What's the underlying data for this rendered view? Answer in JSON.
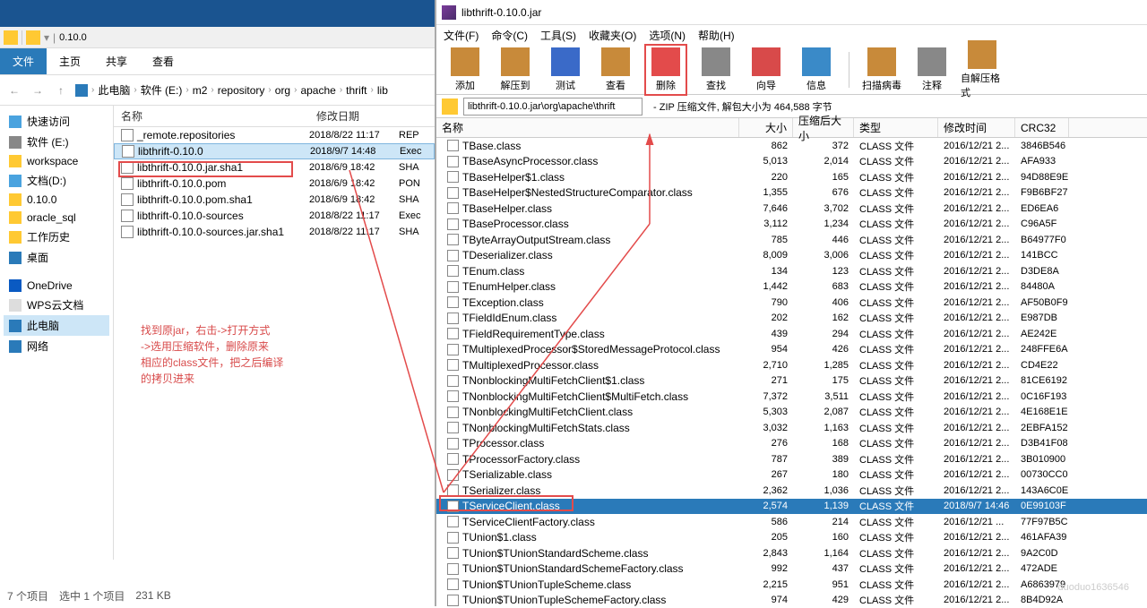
{
  "explorer": {
    "addressbar_text": "0.10.0",
    "tabs": [
      "文件",
      "主页",
      "共享",
      "查看"
    ],
    "breadcrumb": [
      "此电脑",
      "软件 (E:)",
      "m2",
      "repository",
      "org",
      "apache",
      "thrift",
      "lib"
    ],
    "sidebar": [
      {
        "icon": "sb-star",
        "label": "快速访问"
      },
      {
        "icon": "sb-disk",
        "label": "软件 (E:)"
      },
      {
        "icon": "sb-folder",
        "label": "workspace"
      },
      {
        "icon": "sb-doc",
        "label": "文档(D:)"
      },
      {
        "icon": "sb-folder",
        "label": "0.10.0"
      },
      {
        "icon": "sb-folder",
        "label": "oracle_sql"
      },
      {
        "icon": "sb-folder",
        "label": "工作历史"
      },
      {
        "icon": "sb-desktop",
        "label": "桌面"
      },
      {
        "icon": "",
        "label": ""
      },
      {
        "icon": "sb-cloud",
        "label": "OneDrive"
      },
      {
        "icon": "sb-wps",
        "label": "WPS云文档"
      },
      {
        "icon": "sb-pc",
        "label": "此电脑",
        "active": true
      },
      {
        "icon": "sb-net",
        "label": "网络"
      }
    ],
    "columns": {
      "name": "名称",
      "date": "修改日期",
      "type": ""
    },
    "files": [
      {
        "name": "_remote.repositories",
        "date": "2018/8/22 11:17",
        "type": "REP"
      },
      {
        "name": "libthrift-0.10.0",
        "date": "2018/9/7 14:48",
        "type": "Exec",
        "selected": true
      },
      {
        "name": "libthrift-0.10.0.jar.sha1",
        "date": "2018/6/9 18:42",
        "type": "SHA"
      },
      {
        "name": "libthrift-0.10.0.pom",
        "date": "2018/6/9 18:42",
        "type": "PON"
      },
      {
        "name": "libthrift-0.10.0.pom.sha1",
        "date": "2018/6/9 18:42",
        "type": "SHA"
      },
      {
        "name": "libthrift-0.10.0-sources",
        "date": "2018/8/22 11:17",
        "type": "Exec"
      },
      {
        "name": "libthrift-0.10.0-sources.jar.sha1",
        "date": "2018/8/22 11:17",
        "type": "SHA"
      }
    ],
    "statusbar": {
      "items": "7 个项目",
      "selected": "选中 1 个项目",
      "size": "231 KB"
    }
  },
  "annotation": {
    "line1": "找到原jar，右击->打开方式",
    "line2": "->选用压缩软件，删除原来",
    "line3": "相应的class文件，把之后编译",
    "line4": "的拷贝进来"
  },
  "winrar": {
    "title": "libthrift-0.10.0.jar",
    "menu": [
      "文件(F)",
      "命令(C)",
      "工具(S)",
      "收藏夹(O)",
      "选项(N)",
      "帮助(H)"
    ],
    "tools": [
      {
        "label": "添加",
        "color": "#c88a3a"
      },
      {
        "label": "解压到",
        "color": "#c88a3a"
      },
      {
        "label": "测试",
        "color": "#3a6ac8"
      },
      {
        "label": "查看",
        "color": "#c88a3a"
      },
      {
        "label": "删除",
        "color": "#e34b4b",
        "boxed": true
      },
      {
        "label": "查找",
        "color": "#888"
      },
      {
        "label": "向导",
        "color": "#d84a4a"
      },
      {
        "label": "信息",
        "color": "#3a8ac8"
      },
      {
        "label": "",
        "sep": true
      },
      {
        "label": "扫描病毒",
        "color": "#c88a3a"
      },
      {
        "label": "注释",
        "color": "#888"
      },
      {
        "label": "自解压格式",
        "color": "#c88a3a"
      }
    ],
    "address": "libthrift-0.10.0.jar\\org\\apache\\thrift",
    "address_info": "- ZIP 压缩文件, 解包大小为 464,588 字节",
    "columns": {
      "name": "名称",
      "size": "大小",
      "packed": "压缩后大小",
      "type": "类型",
      "date": "修改时间",
      "crc": "CRC32"
    },
    "rows": [
      {
        "name": "TBase.class",
        "size": "862",
        "packed": "372",
        "type": "CLASS 文件",
        "date": "2016/12/21 2...",
        "crc": "3846B546"
      },
      {
        "name": "TBaseAsyncProcessor.class",
        "size": "5,013",
        "packed": "2,014",
        "type": "CLASS 文件",
        "date": "2016/12/21 2...",
        "crc": "AFA933"
      },
      {
        "name": "TBaseHelper$1.class",
        "size": "220",
        "packed": "165",
        "type": "CLASS 文件",
        "date": "2016/12/21 2...",
        "crc": "94D88E9E"
      },
      {
        "name": "TBaseHelper$NestedStructureComparator.class",
        "size": "1,355",
        "packed": "676",
        "type": "CLASS 文件",
        "date": "2016/12/21 2...",
        "crc": "F9B6BF27"
      },
      {
        "name": "TBaseHelper.class",
        "size": "7,646",
        "packed": "3,702",
        "type": "CLASS 文件",
        "date": "2016/12/21 2...",
        "crc": "ED6EA6"
      },
      {
        "name": "TBaseProcessor.class",
        "size": "3,112",
        "packed": "1,234",
        "type": "CLASS 文件",
        "date": "2016/12/21 2...",
        "crc": "C96A5F"
      },
      {
        "name": "TByteArrayOutputStream.class",
        "size": "785",
        "packed": "446",
        "type": "CLASS 文件",
        "date": "2016/12/21 2...",
        "crc": "B64977F0"
      },
      {
        "name": "TDeserializer.class",
        "size": "8,009",
        "packed": "3,006",
        "type": "CLASS 文件",
        "date": "2016/12/21 2...",
        "crc": "141BCC"
      },
      {
        "name": "TEnum.class",
        "size": "134",
        "packed": "123",
        "type": "CLASS 文件",
        "date": "2016/12/21 2...",
        "crc": "D3DE8A"
      },
      {
        "name": "TEnumHelper.class",
        "size": "1,442",
        "packed": "683",
        "type": "CLASS 文件",
        "date": "2016/12/21 2...",
        "crc": "84480A"
      },
      {
        "name": "TException.class",
        "size": "790",
        "packed": "406",
        "type": "CLASS 文件",
        "date": "2016/12/21 2...",
        "crc": "AF50B0F9"
      },
      {
        "name": "TFieldIdEnum.class",
        "size": "202",
        "packed": "162",
        "type": "CLASS 文件",
        "date": "2016/12/21 2...",
        "crc": "E987DB"
      },
      {
        "name": "TFieldRequirementType.class",
        "size": "439",
        "packed": "294",
        "type": "CLASS 文件",
        "date": "2016/12/21 2...",
        "crc": "AE242E"
      },
      {
        "name": "TMultiplexedProcessor$StoredMessageProtocol.class",
        "size": "954",
        "packed": "426",
        "type": "CLASS 文件",
        "date": "2016/12/21 2...",
        "crc": "248FFE6A"
      },
      {
        "name": "TMultiplexedProcessor.class",
        "size": "2,710",
        "packed": "1,285",
        "type": "CLASS 文件",
        "date": "2016/12/21 2...",
        "crc": "CD4E22"
      },
      {
        "name": "TNonblockingMultiFetchClient$1.class",
        "size": "271",
        "packed": "175",
        "type": "CLASS 文件",
        "date": "2016/12/21 2...",
        "crc": "81CE6192"
      },
      {
        "name": "TNonblockingMultiFetchClient$MultiFetch.class",
        "size": "7,372",
        "packed": "3,511",
        "type": "CLASS 文件",
        "date": "2016/12/21 2...",
        "crc": "0C16F193"
      },
      {
        "name": "TNonblockingMultiFetchClient.class",
        "size": "5,303",
        "packed": "2,087",
        "type": "CLASS 文件",
        "date": "2016/12/21 2...",
        "crc": "4E168E1E"
      },
      {
        "name": "TNonblockingMultiFetchStats.class",
        "size": "3,032",
        "packed": "1,163",
        "type": "CLASS 文件",
        "date": "2016/12/21 2...",
        "crc": "2EBFA152"
      },
      {
        "name": "TProcessor.class",
        "size": "276",
        "packed": "168",
        "type": "CLASS 文件",
        "date": "2016/12/21 2...",
        "crc": "D3B41F08"
      },
      {
        "name": "TProcessorFactory.class",
        "size": "787",
        "packed": "389",
        "type": "CLASS 文件",
        "date": "2016/12/21 2...",
        "crc": "3B010900"
      },
      {
        "name": "TSerializable.class",
        "size": "267",
        "packed": "180",
        "type": "CLASS 文件",
        "date": "2016/12/21 2...",
        "crc": "00730CC0"
      },
      {
        "name": "TSerializer.class",
        "size": "2,362",
        "packed": "1,036",
        "type": "CLASS 文件",
        "date": "2016/12/21 2...",
        "crc": "143A6C0E"
      },
      {
        "name": "TServiceClient.class",
        "size": "2,574",
        "packed": "1,139",
        "type": "CLASS 文件",
        "date": "2018/9/7 14:46",
        "crc": "0E99103F",
        "selected": true
      },
      {
        "name": "TServiceClientFactory.class",
        "size": "586",
        "packed": "214",
        "type": "CLASS 文件",
        "date": "2016/12/21 ...",
        "crc": "77F97B5C"
      },
      {
        "name": "TUnion$1.class",
        "size": "205",
        "packed": "160",
        "type": "CLASS 文件",
        "date": "2016/12/21 2...",
        "crc": "461AFA39"
      },
      {
        "name": "TUnion$TUnionStandardScheme.class",
        "size": "2,843",
        "packed": "1,164",
        "type": "CLASS 文件",
        "date": "2016/12/21 2...",
        "crc": "9A2C0D"
      },
      {
        "name": "TUnion$TUnionStandardSchemeFactory.class",
        "size": "992",
        "packed": "437",
        "type": "CLASS 文件",
        "date": "2016/12/21 2...",
        "crc": "472ADE"
      },
      {
        "name": "TUnion$TUnionTupleScheme.class",
        "size": "2,215",
        "packed": "951",
        "type": "CLASS 文件",
        "date": "2016/12/21 2...",
        "crc": "A6863979"
      },
      {
        "name": "TUnion$TUnionTupleSchemeFactory.class",
        "size": "974",
        "packed": "429",
        "type": "CLASS 文件",
        "date": "2016/12/21 2...",
        "crc": "8B4D92A"
      }
    ]
  },
  "watermark": "duoduo1636546"
}
